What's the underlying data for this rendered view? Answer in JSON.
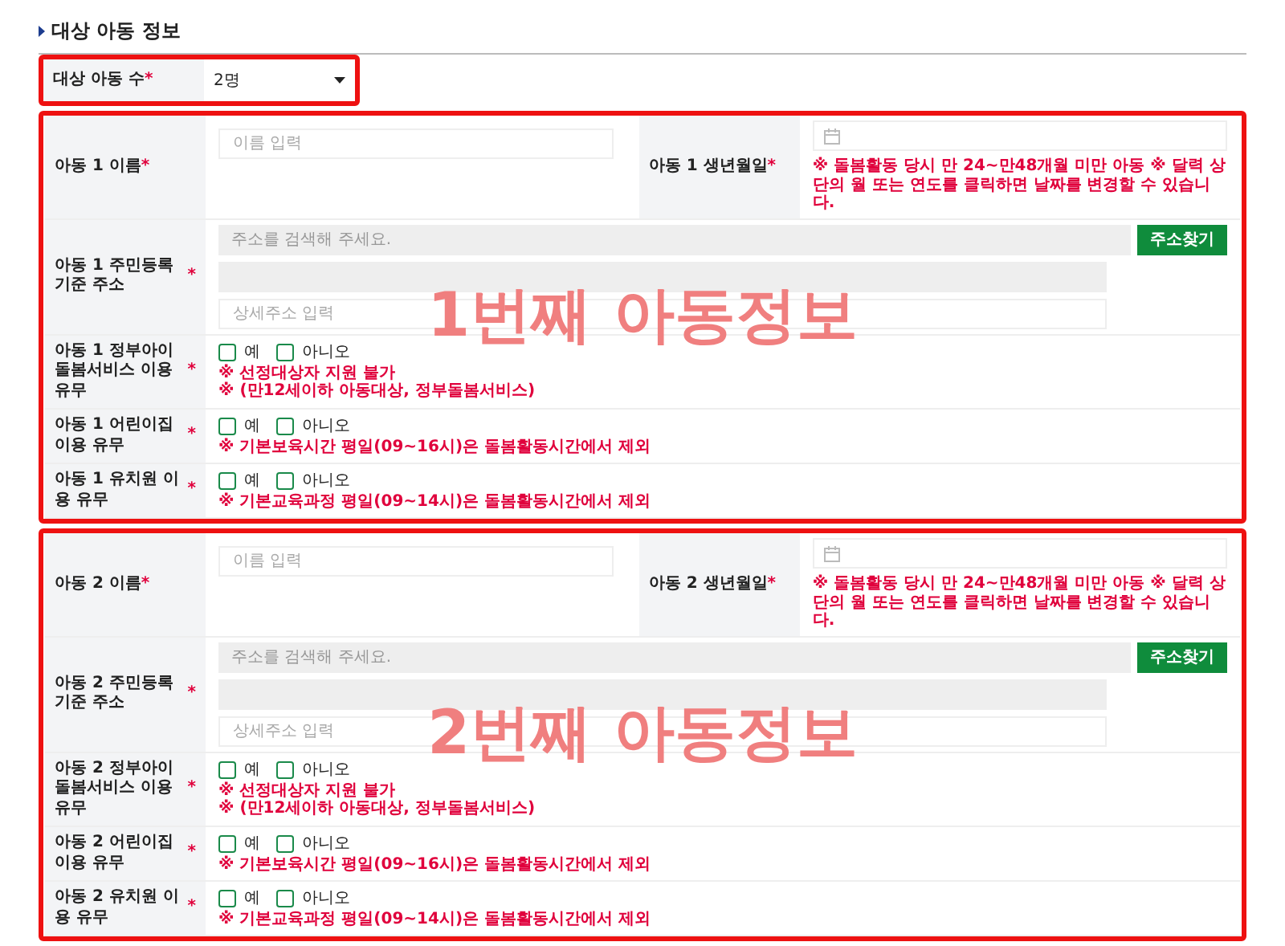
{
  "section_title": "대상 아동 정보",
  "child_count": {
    "label": "대상 아동 수",
    "required_mark": "*",
    "value": "2명",
    "highlighted": true
  },
  "children": [
    {
      "highlighted": true,
      "annotation": "1번째 아동정보",
      "name": {
        "label": "아동 1 이름",
        "required_mark": "*",
        "placeholder": "이름 입력"
      },
      "birth": {
        "label": "아동 1 생년월일",
        "required_mark": "*",
        "note": "※ 돌봄활동 당시 만 24~만48개월 미만 아동 ※ 달력 상단의 월 또는 연도를 클릭하면 날짜를 변경할 수 있습니다."
      },
      "address": {
        "label": "아동 1 주민등록기준 주소",
        "required_mark": "*",
        "search_placeholder": "주소를 검색해 주세요.",
        "search_button": "주소찾기",
        "detail_placeholder": "상세주소 입력"
      },
      "questions": [
        {
          "label": "아동 1 정부아이돌봄서비스 이용 유무",
          "required_mark": "*",
          "options": [
            {
              "label": "예",
              "checked": false
            },
            {
              "label": "아니오",
              "checked": false
            }
          ],
          "notes": [
            "※ 선정대상자 지원 불가",
            "※ (만12세이하 아동대상, 정부돌봄서비스)"
          ]
        },
        {
          "label": "아동 1 어린이집 이용 유무",
          "required_mark": "*",
          "options": [
            {
              "label": "예",
              "checked": false
            },
            {
              "label": "아니오",
              "checked": false
            }
          ],
          "notes": [
            "※ 기본보육시간 평일(09~16시)은 돌봄활동시간에서 제외"
          ]
        },
        {
          "label": "아동 1 유치원 이용 유무",
          "required_mark": "*",
          "options": [
            {
              "label": "예",
              "checked": false
            },
            {
              "label": "아니오",
              "checked": false
            }
          ],
          "notes": [
            "※ 기본교육과정 평일(09~14시)은 돌봄활동시간에서 제외"
          ]
        }
      ]
    },
    {
      "highlighted": true,
      "annotation": "2번째 아동정보",
      "name": {
        "label": "아동 2 이름",
        "required_mark": "*",
        "placeholder": "이름 입력"
      },
      "birth": {
        "label": "아동 2 생년월일",
        "required_mark": "*",
        "note": "※ 돌봄활동 당시 만 24~만48개월 미만 아동 ※ 달력 상단의 월 또는 연도를 클릭하면 날짜를 변경할 수 있습니다."
      },
      "address": {
        "label": "아동 2 주민등록기준 주소",
        "required_mark": "*",
        "search_placeholder": "주소를 검색해 주세요.",
        "search_button": "주소찾기",
        "detail_placeholder": "상세주소 입력"
      },
      "questions": [
        {
          "label": "아동 2 정부아이돌봄서비스 이용 유무",
          "required_mark": "*",
          "options": [
            {
              "label": "예",
              "checked": false
            },
            {
              "label": "아니오",
              "checked": false
            }
          ],
          "notes": [
            "※ 선정대상자 지원 불가",
            "※ (만12세이하 아동대상, 정부돌봄서비스)"
          ]
        },
        {
          "label": "아동 2 어린이집 이용 유무",
          "required_mark": "*",
          "options": [
            {
              "label": "예",
              "checked": false
            },
            {
              "label": "아니오",
              "checked": false
            }
          ],
          "notes": [
            "※ 기본보육시간 평일(09~16시)은 돌봄활동시간에서 제외"
          ]
        },
        {
          "label": "아동 2 유치원 이용 유무",
          "required_mark": "*",
          "options": [
            {
              "label": "예",
              "checked": false
            },
            {
              "label": "아니오",
              "checked": false
            }
          ],
          "notes": [
            "※ 기본교육과정 평일(09~14시)은 돌봄활동시간에서 제외"
          ]
        }
      ]
    }
  ]
}
